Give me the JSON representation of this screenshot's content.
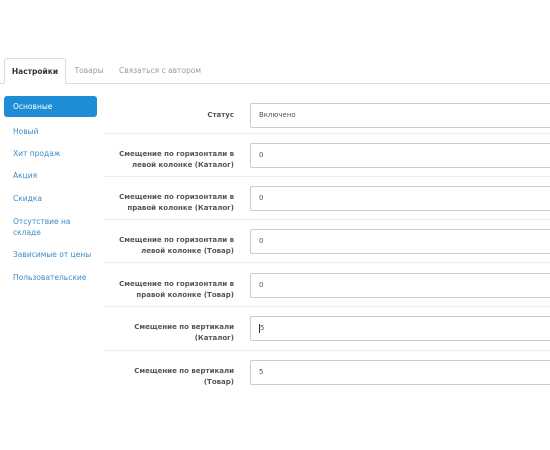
{
  "tabs": [
    {
      "label": "Настройки",
      "active": true
    },
    {
      "label": "Товары",
      "active": false
    },
    {
      "label": "Связаться с автором",
      "active": false
    }
  ],
  "sidebar": {
    "items": [
      {
        "label": "Основные",
        "active": true
      },
      {
        "label": "Новый",
        "active": false
      },
      {
        "label": "Хит продаж",
        "active": false
      },
      {
        "label": "Акция",
        "active": false
      },
      {
        "label": "Скидка",
        "active": false
      },
      {
        "label": "Отсутствие на складе",
        "active": false
      },
      {
        "label": "Зависимые от цены",
        "active": false
      },
      {
        "label": "Пользовательские",
        "active": false
      }
    ]
  },
  "form": {
    "rows": [
      {
        "label": "Статус",
        "value": "Включено",
        "type": "select"
      },
      {
        "label": "Смещение по горизонтали в левой колонке (Каталог)",
        "value": "0",
        "type": "input"
      },
      {
        "label": "Смещение по горизонтали в правой колонке (Каталог)",
        "value": "0",
        "type": "input"
      },
      {
        "label": "Смещение по горизонтали в левой колонке (Товар)",
        "value": "0",
        "type": "input"
      },
      {
        "label": "Смещение по горизонтали в правой колонке (Товар)",
        "value": "0",
        "type": "input"
      },
      {
        "label": "Смещение по вертикали (Каталог)",
        "value": "5",
        "type": "input"
      },
      {
        "label": "Смещение по вертикали (Товар)",
        "value": "5",
        "type": "input"
      }
    ]
  },
  "colors": {
    "accent": "#1f8dd6",
    "link": "#3a8ccb",
    "border": "#dddddd"
  }
}
